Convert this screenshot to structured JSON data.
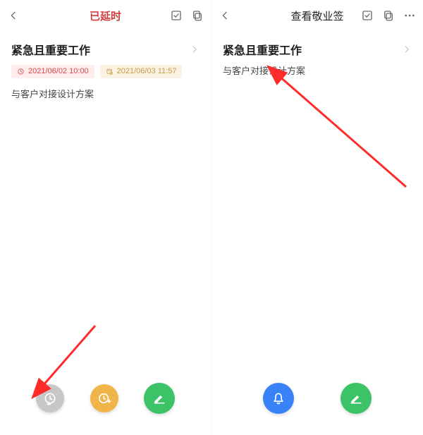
{
  "left": {
    "header_title": "已延时",
    "section_title": "紧急且重要工作",
    "badges": {
      "red_time": "2021/06/02 10:00",
      "amber_time": "2021/06/03 11:57"
    },
    "note_text": "与客户对接设计方案"
  },
  "right": {
    "header_title": "查看敬业签",
    "section_title": "紧急且重要工作",
    "note_text": "与客户对接设计方案"
  },
  "colors": {
    "title_red": "#d43b3b",
    "badge_red_bg": "#ffecec",
    "badge_red_fg": "#d44a4a",
    "badge_amber_bg": "#fbf2e2",
    "badge_amber_fg": "#c79a4a",
    "fab_grey": "#c7c7c7",
    "fab_orange": "#efb54b",
    "fab_green": "#3cc367",
    "fab_blue": "#3a82f7",
    "arrow_red": "#ff2a2a"
  },
  "icons": {
    "back": "chevron-left-icon",
    "check_box": "checkbox-icon",
    "copy": "copy-icon",
    "more": "more-icon",
    "chev_right": "chevron-right-icon",
    "clock": "clock-icon",
    "calendar_clock": "calendar-clock-icon",
    "fab_history": "clock-history-icon",
    "fab_clock_add": "clock-add-icon",
    "fab_edit": "edit-icon",
    "fab_bell": "bell-icon"
  }
}
